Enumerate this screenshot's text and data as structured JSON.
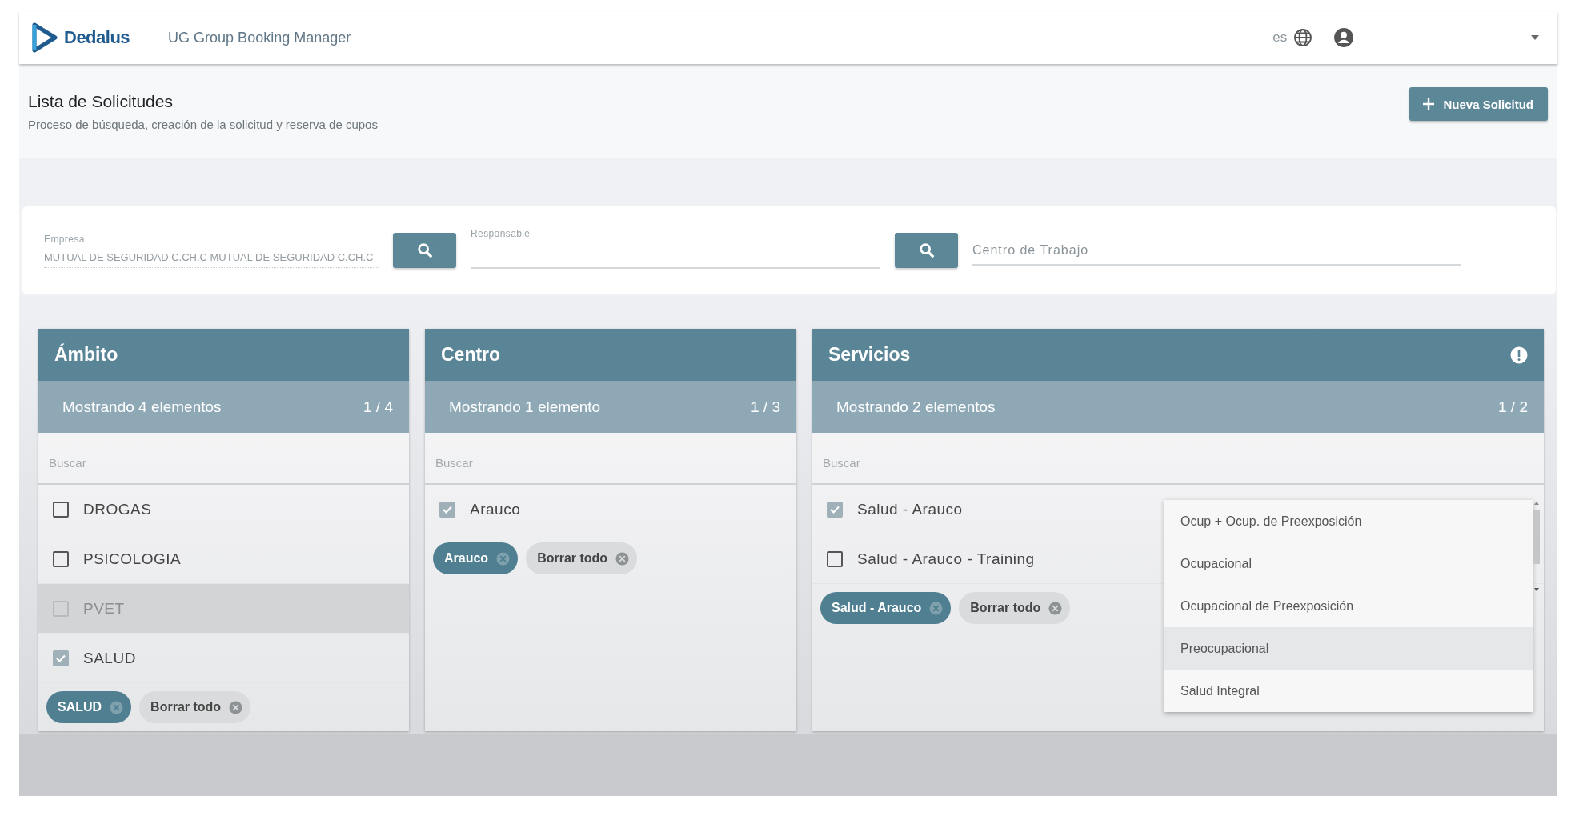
{
  "header": {
    "brand": "Dedalus",
    "app_title": "UG Group Booking Manager",
    "language": "es"
  },
  "page": {
    "title": "Lista de Solicitudes",
    "subtitle": "Proceso de búsqueda, creación de la solicitud y reserva de cupos",
    "new_button": "Nueva Solicitud"
  },
  "filters": {
    "empresa": {
      "label": "Empresa",
      "value": "MUTUAL DE SEGURIDAD C.CH.C MUTUAL DE SEGURIDAD C.CH.C"
    },
    "responsable": {
      "label": "Responsable"
    },
    "centro_trabajo": {
      "placeholder": "Centro de Trabajo"
    }
  },
  "panels": [
    {
      "title": "Ámbito",
      "summary": "Mostrando 4 elementos",
      "counter": "1 / 4",
      "search_placeholder": "Buscar",
      "alert_icon": false,
      "items": [
        {
          "label": "DROGAS",
          "checked": false,
          "disabled": false
        },
        {
          "label": "PSICOLOGIA",
          "checked": false,
          "disabled": false
        },
        {
          "label": "PVET",
          "checked": false,
          "disabled": true
        },
        {
          "label": "SALUD",
          "checked": true,
          "disabled": false
        }
      ],
      "chips": [
        {
          "label": "SALUD",
          "kind": "value"
        },
        {
          "label": "Borrar todo",
          "kind": "clear"
        }
      ]
    },
    {
      "title": "Centro",
      "summary": "Mostrando 1 elemento",
      "counter": "1 / 3",
      "search_placeholder": "Buscar",
      "alert_icon": false,
      "items": [
        {
          "label": "Arauco",
          "checked": true,
          "disabled": false
        }
      ],
      "chips": [
        {
          "label": "Arauco",
          "kind": "value"
        },
        {
          "label": "Borrar todo",
          "kind": "clear"
        }
      ]
    },
    {
      "title": "Servicios",
      "summary": "Mostrando 2 elementos",
      "counter": "1 / 2",
      "search_placeholder": "Buscar",
      "alert_icon": true,
      "items": [
        {
          "label": "Salud - Arauco",
          "checked": true,
          "disabled": false
        },
        {
          "label": "Salud - Arauco - Training",
          "checked": false,
          "disabled": false
        }
      ],
      "chips": [
        {
          "label": "Salud - Arauco",
          "kind": "value"
        },
        {
          "label": "Borrar todo",
          "kind": "clear"
        }
      ],
      "dropdown": [
        {
          "label": "Ocup + Ocup. de Preexposición",
          "selected": false
        },
        {
          "label": "Ocupacional",
          "selected": false
        },
        {
          "label": "Ocupacional de Preexposición",
          "selected": false
        },
        {
          "label": "Preocupacional",
          "selected": true
        },
        {
          "label": "Salud Integral",
          "selected": false
        }
      ]
    }
  ]
}
